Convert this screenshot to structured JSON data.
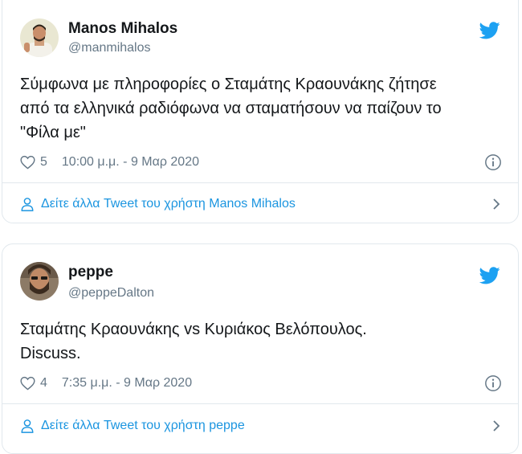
{
  "tweets": [
    {
      "name": "Manos Mihalos",
      "handle": "@manmihalos",
      "text_lines": [
        "Σύμφωνα με πληροφορίες ο Σταμάτης Κραουνάκης ζήτησε",
        "από τα ελληνικά ραδιόφωνα να σταματήσουν να παίζουν το",
        "\"Φίλα με\""
      ],
      "likes": "5",
      "timestamp": "10:00 μ.μ. - 9 Μαρ 2020",
      "see_more": "Δείτε άλλα Tweet του χρήστη Manos Mihalos"
    },
    {
      "name": "peppe",
      "handle": "@peppeDalton",
      "text_lines": [
        "Σταμάτης Κραουνάκης vs Κυριάκος Βελόπουλος.",
        "Discuss."
      ],
      "likes": "4",
      "timestamp": "7:35 μ.μ. - 9 Μαρ 2020",
      "see_more": "Δείτε άλλα Tweet του χρήστη peppe"
    }
  ],
  "colors": {
    "accent": "#1b95e0",
    "bird": "#1da1f2",
    "secondary_text": "#657786",
    "border": "#e1e8ed"
  },
  "icons": [
    "twitter-bird-icon",
    "heart-icon",
    "info-icon",
    "person-icon",
    "chevron-right-icon"
  ]
}
